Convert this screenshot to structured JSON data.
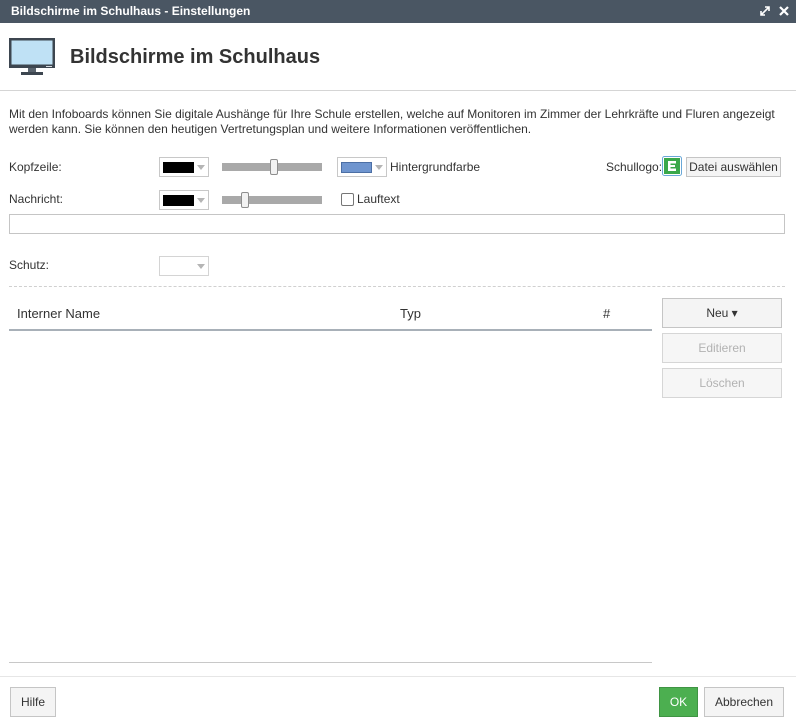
{
  "window": {
    "title": "Bildschirme im Schulhaus - Einstellungen",
    "heading": "Bildschirme im Schulhaus"
  },
  "description": "Mit den Infoboards können Sie digitale Aushänge für Ihre Schule erstellen, welche auf Monitoren im Zimmer der Lehrkräfte und Fluren angezeigt werden kann. Sie können den heutigen Vertretungsplan und weitere Informationen veröffentlichen.",
  "form": {
    "kopfzeile_label": "Kopfzeile:",
    "kopfzeile_color": "#000000",
    "kopfzeile_slider_value": 0.5,
    "background_color": "#6f95cf",
    "background_label": "Hintergrundfarbe",
    "schullogo_label": "Schullogo:",
    "file_button": "Datei auswählen",
    "nachricht_label": "Nachricht:",
    "nachricht_color": "#000000",
    "nachricht_slider_value": 0.2,
    "lauftext_label": "Lauftext",
    "lauftext_checked": false,
    "nachricht_text": "",
    "schutz_label": "Schutz:",
    "schutz_value": ""
  },
  "table": {
    "columns": [
      "Interner Name",
      "Typ",
      "#"
    ],
    "rows": []
  },
  "side_buttons": {
    "new": "Neu ▾",
    "edit": "Editieren",
    "delete": "Löschen"
  },
  "footer": {
    "help": "Hilfe",
    "ok": "OK",
    "cancel": "Abbrechen"
  },
  "colors": {
    "titlebar": "#4a5663",
    "accent_ok": "#4caf50",
    "logo_green": "#3aa84a"
  }
}
